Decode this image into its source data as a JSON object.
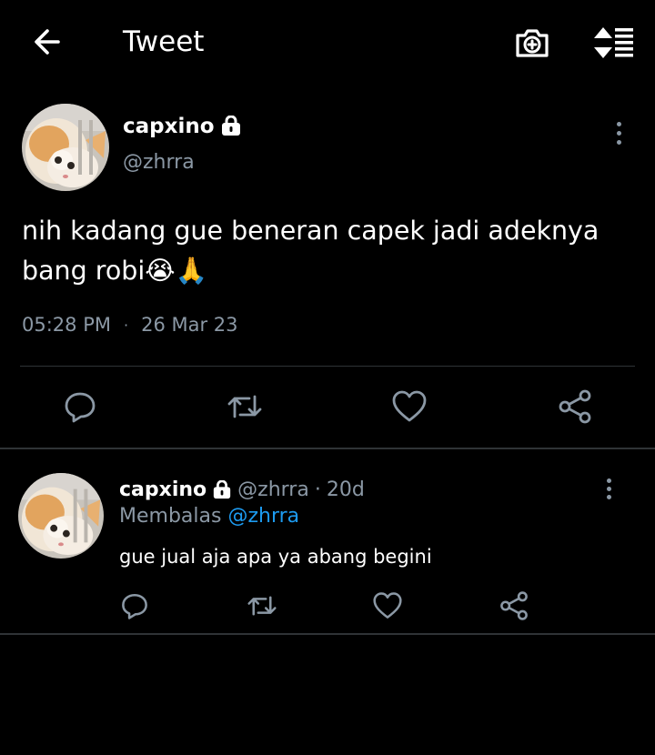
{
  "header": {
    "title": "Tweet",
    "back_icon": "arrow-left-icon",
    "camera_icon": "camera-plus-icon",
    "sort_icon": "sort-icon"
  },
  "main_tweet": {
    "display_name": "capxino",
    "handle": "@zhrra",
    "text": "nih kadang gue beneran capek jadi adeknya bang robi😭🙏",
    "time": "05:28 PM",
    "separator": "·",
    "date": "26 Mar 23"
  },
  "reply": {
    "display_name": "capxino",
    "handle": "@zhrra",
    "separator": "·",
    "age": "20d",
    "replying_prefix": "Membalas",
    "replying_to": "@zhrra",
    "text": "gue jual aja apa ya abang begini"
  },
  "colors": {
    "background": "#000000",
    "text": "#ffffff",
    "secondary": "#8b98a5",
    "divider": "#2f3336",
    "accent": "#1d9bf0"
  }
}
